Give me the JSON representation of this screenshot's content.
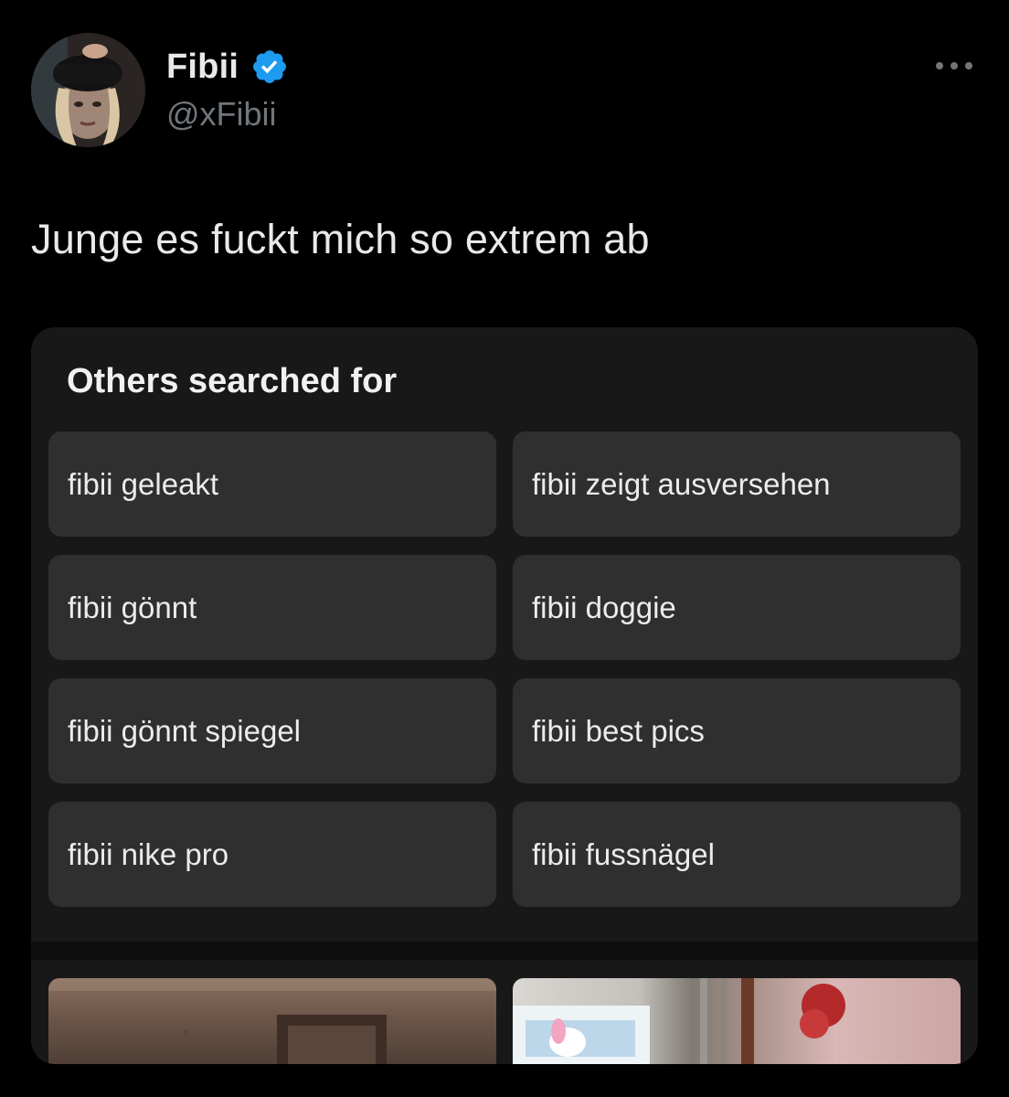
{
  "author": {
    "display_name": "Fibii",
    "handle": "@xFibii",
    "verified_icon": "verified-badge-icon",
    "avatar_icon": "profile-photo"
  },
  "more_icon": "more-horizontal-icon",
  "tweet": {
    "text": "Junge es fuckt mich so extrem ab"
  },
  "media_card": {
    "title": "Others searched for",
    "suggestions": [
      "fibii geleakt",
      "fibii zeigt ausversehen",
      "fibii gönnt",
      "fibii doggie",
      "fibii gönnt spiegel",
      "fibii best pics",
      "fibii nike pro",
      "fibii fussnägel"
    ],
    "thumbnails": [
      "room-photo",
      "desk-photo"
    ]
  },
  "colors": {
    "background": "#000000",
    "card_background": "#181818",
    "chip_background": "#2f2f2f",
    "verified_blue": "#1d9bf0",
    "secondary_text": "#71767b"
  }
}
